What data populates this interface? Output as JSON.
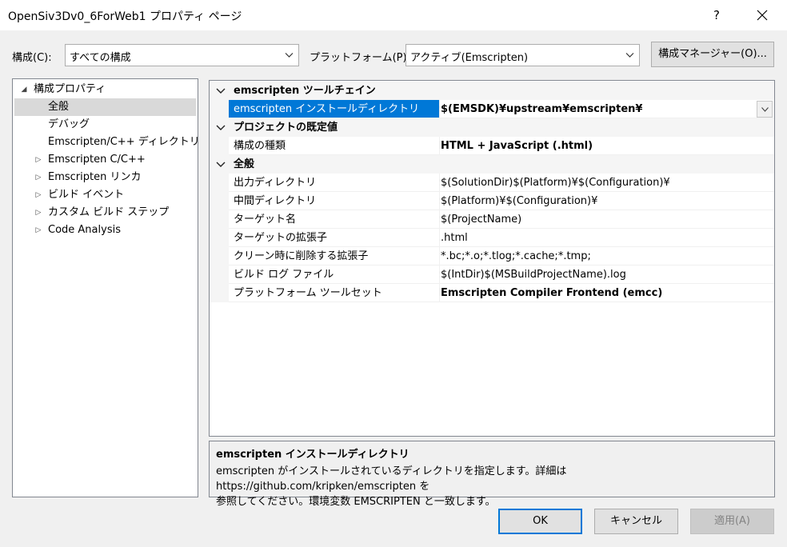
{
  "window": {
    "title": "OpenSiv3Dv0_6ForWeb1 プロパティ ページ",
    "help_label": "?"
  },
  "toolbar": {
    "config_label": "構成(C):",
    "config_value": "すべての構成",
    "platform_label": "プラットフォーム(P):",
    "platform_value": "アクティブ(Emscripten)",
    "config_manager_label": "構成マネージャー(O)..."
  },
  "tree": {
    "root": "構成プロパティ",
    "items": [
      "全般",
      "デバッグ",
      "Emscripten/C++ ディレクトリ",
      "Emscripten C/C++",
      "Emscripten リンカ",
      "ビルド イベント",
      "カスタム ビルド ステップ",
      "Code Analysis"
    ]
  },
  "grid": {
    "categories": [
      {
        "label": "emscripten ツールチェイン",
        "rows": [
          {
            "name": "emscripten インストールディレクトリ",
            "value": "$(EMSDK)¥upstream¥emscripten¥"
          }
        ]
      },
      {
        "label": "プロジェクトの既定値",
        "rows": [
          {
            "name": "構成の種類",
            "value": "HTML + JavaScript (.html)"
          }
        ]
      },
      {
        "label": "全般",
        "rows": [
          {
            "name": "出力ディレクトリ",
            "value": "$(SolutionDir)$(Platform)¥$(Configuration)¥"
          },
          {
            "name": "中間ディレクトリ",
            "value": "$(Platform)¥$(Configuration)¥"
          },
          {
            "name": "ターゲット名",
            "value": "$(ProjectName)"
          },
          {
            "name": "ターゲットの拡張子",
            "value": ".html"
          },
          {
            "name": "クリーン時に削除する拡張子",
            "value": "*.bc;*.o;*.tlog;*.cache;*.tmp;"
          },
          {
            "name": "ビルド ログ ファイル",
            "value": "$(IntDir)$(MSBuildProjectName).log"
          },
          {
            "name": "プラットフォーム ツールセット",
            "value": "Emscripten Compiler Frontend (emcc)"
          }
        ]
      }
    ]
  },
  "description": {
    "title": "emscripten インストールディレクトリ",
    "line1": "emscripten がインストールされているディレクトリを指定します。詳細は https://github.com/kripken/emscripten を",
    "line2": "参照してください。環境変数 EMSCRIPTEN と一致します。"
  },
  "buttons": {
    "ok": "OK",
    "cancel": "キャンセル",
    "apply": "適用(A)"
  },
  "colors": {
    "selection": "#0078d7",
    "tree_selection": "#d9d9d9",
    "background": "#f0f0f0"
  }
}
